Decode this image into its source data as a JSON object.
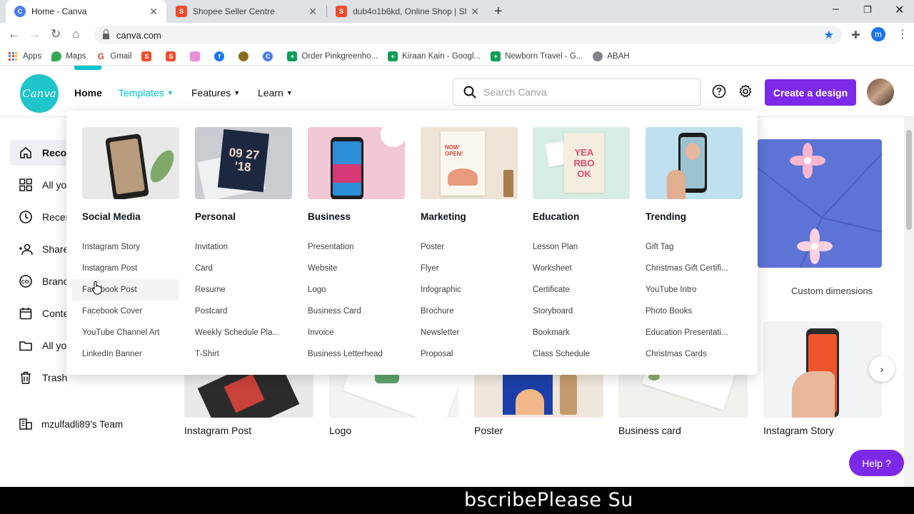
{
  "browser": {
    "tabs": [
      {
        "title": "Home - Canva",
        "active": true
      },
      {
        "title": "Shopee Seller Centre",
        "active": false
      },
      {
        "title": "dub4o1b6kd, Online Shop | Shop",
        "active": false
      }
    ],
    "url": "canva.com",
    "profile_initial": "m",
    "bookmarks": [
      "Apps",
      "Maps",
      "Gmail",
      "Order Pinkgreenho...",
      "Kiraan Kain - Googl...",
      "Newborn Travel - G...",
      "ABAH"
    ]
  },
  "header": {
    "logo_text": "Canva",
    "nav": [
      {
        "label": "Home"
      },
      {
        "label": "Templates"
      },
      {
        "label": "Features"
      },
      {
        "label": "Learn"
      }
    ],
    "search_placeholder": "Search Canva",
    "create_button": "Create a design"
  },
  "sidebar": {
    "items": [
      {
        "label": "Recon"
      },
      {
        "label": "All yo"
      },
      {
        "label": "Recen"
      },
      {
        "label": "Share"
      },
      {
        "label": "Branc"
      },
      {
        "label": "Conte"
      },
      {
        "label": "All yo"
      },
      {
        "label": "Trash"
      }
    ],
    "team": "mzulfadli89's Team"
  },
  "dropdown": {
    "columns": [
      {
        "heading": "Social Media",
        "items": [
          "Instagram Story",
          "Instagram Post",
          "Facebook Post",
          "Facebook Cover",
          "YouTube Channel Art",
          "LinkedIn Banner"
        ]
      },
      {
        "heading": "Personal",
        "thumb_text": "09 27 '18",
        "items": [
          "Invitation",
          "Card",
          "Resume",
          "Postcard",
          "Weekly Schedule Pla...",
          "T-Shirt"
        ]
      },
      {
        "heading": "Business",
        "items": [
          "Presentation",
          "Website",
          "Logo",
          "Business Card",
          "Invoice",
          "Business Letterhead"
        ]
      },
      {
        "heading": "Marketing",
        "thumb_text": "NOW OPEN!",
        "items": [
          "Poster",
          "Flyer",
          "Infographic",
          "Brochure",
          "Newsletter",
          "Proposal"
        ]
      },
      {
        "heading": "Education",
        "thumb_text": "YEARBOOK",
        "items": [
          "Lesson Plan",
          "Worksheet",
          "Certificate",
          "Storyboard",
          "Bookmark",
          "Class Schedule"
        ]
      },
      {
        "heading": "Trending",
        "items": [
          "Gift Tag",
          "Christmas Gift Certifi...",
          "YouTube Intro",
          "Photo Books",
          "Education Presentati...",
          "Christmas Cards"
        ]
      }
    ],
    "hovered_item": "Facebook Post"
  },
  "content": {
    "custom_dimensions": "Custom dimensions",
    "designs": [
      "Instagram Post",
      "Logo",
      "Poster",
      "Business card",
      "Instagram Story"
    ],
    "help_button": "Help ?"
  },
  "caption": "bscribePlease Su",
  "colors": {
    "brand_teal": "#00c4cc",
    "brand_purple": "#7d2ae8"
  }
}
